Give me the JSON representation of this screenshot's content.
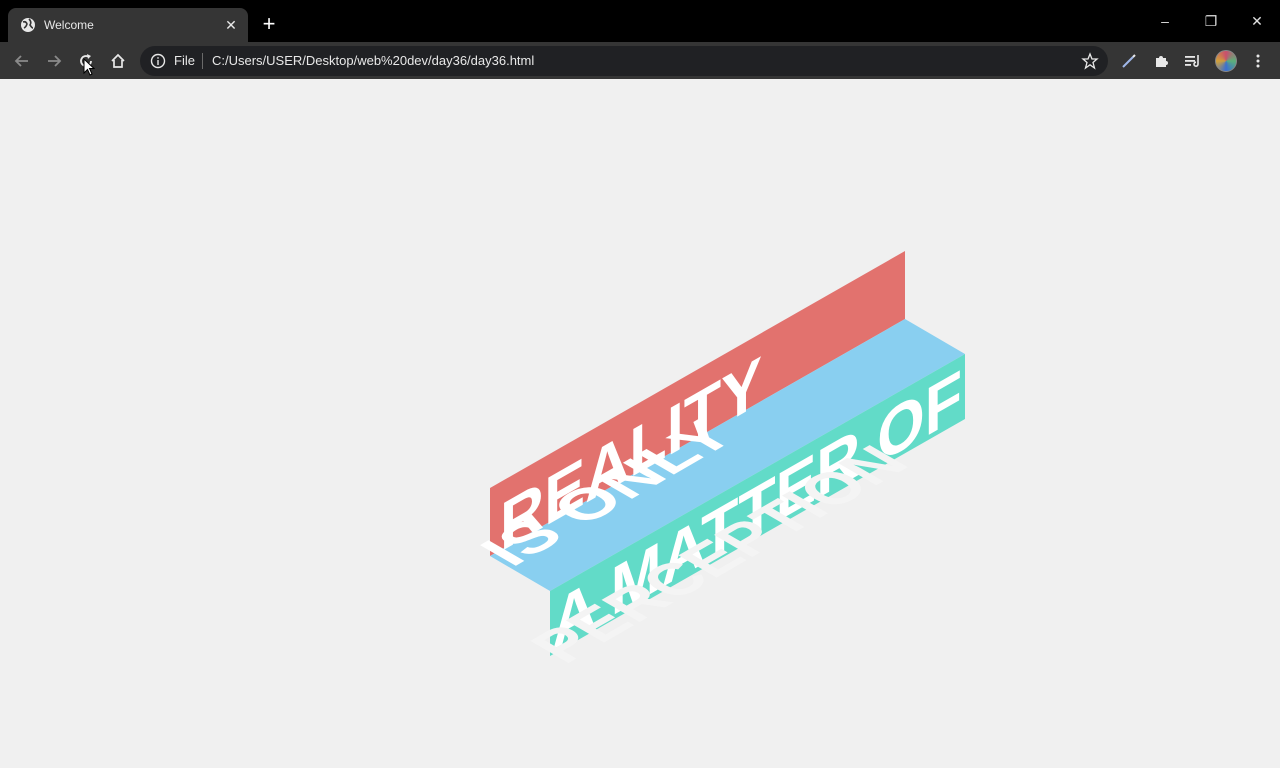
{
  "browser": {
    "tab": {
      "title": "Welcome",
      "close_glyph": "✕"
    },
    "new_tab_glyph": "+",
    "window_controls": {
      "minimize": "–",
      "restore": "❐",
      "close": "✕"
    },
    "omnibox": {
      "scheme": "File",
      "url": "C:/Users/USER/Desktop/web%20dev/day36/day36.html"
    }
  },
  "page": {
    "lines": [
      {
        "text": "REALITY",
        "color": "#e2726e"
      },
      {
        "text": "IS ONLY",
        "color": "#89cff0"
      },
      {
        "text": "A MATTER OF",
        "color": "#62dbc8"
      },
      {
        "text": "PERCEPTION",
        "color": "#f4f4f4"
      }
    ],
    "text_color": "#ffffff"
  },
  "colors": {
    "chrome_dark": "#000000",
    "toolbar": "#353535",
    "omnibox": "#202124",
    "page_bg": "#f0f0f0"
  }
}
